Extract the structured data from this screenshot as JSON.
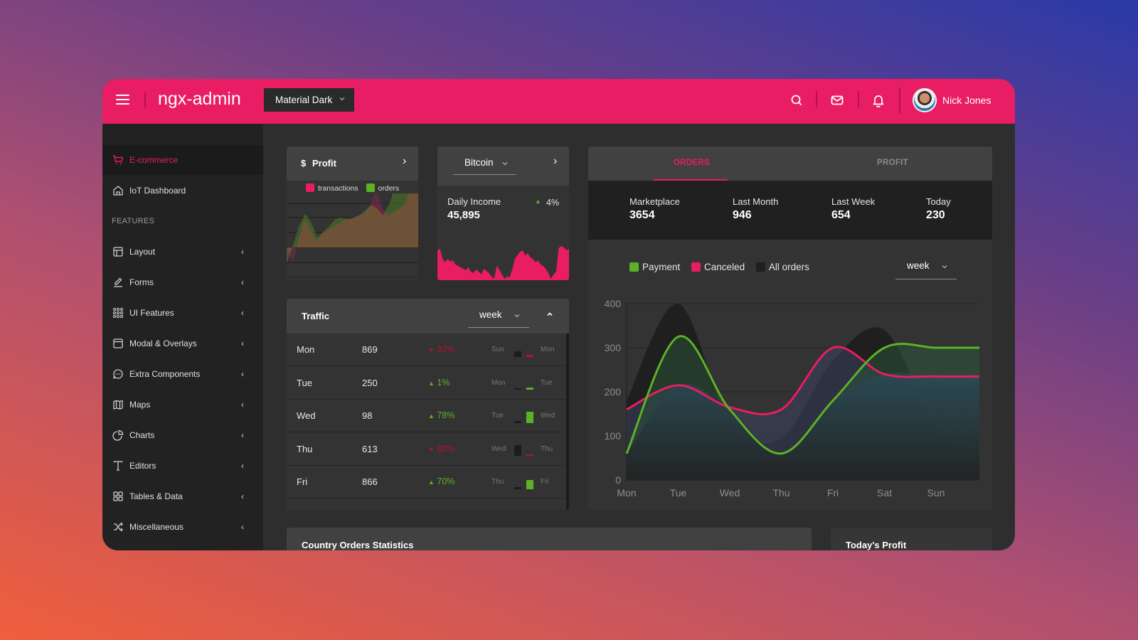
{
  "header": {
    "brand": "ngx-admin",
    "theme": "Material Dark",
    "user_name": "Nick Jones",
    "icons": [
      "menu-icon",
      "search-icon",
      "mail-icon",
      "bell-icon"
    ]
  },
  "sidebar": {
    "items": [
      {
        "label": "E-commerce",
        "icon": "shopping-cart-icon",
        "active": true
      },
      {
        "label": "IoT Dashboard",
        "icon": "home-icon"
      }
    ],
    "group_label": "FEATURES",
    "feature_items": [
      {
        "label": "Layout",
        "icon": "layout-icon"
      },
      {
        "label": "Forms",
        "icon": "edit-icon"
      },
      {
        "label": "UI Features",
        "icon": "grid-dots-icon"
      },
      {
        "label": "Modal & Overlays",
        "icon": "browser-icon"
      },
      {
        "label": "Extra Components",
        "icon": "message-circle-icon"
      },
      {
        "label": "Maps",
        "icon": "map-icon"
      },
      {
        "label": "Charts",
        "icon": "pie-chart-icon"
      },
      {
        "label": "Editors",
        "icon": "text-icon"
      },
      {
        "label": "Tables & Data",
        "icon": "grid-icon"
      },
      {
        "label": "Miscellaneous",
        "icon": "shuffle-icon"
      }
    ]
  },
  "profit_card": {
    "title": "Profit",
    "currency_symbol": "$",
    "legend": [
      {
        "label": "transactions",
        "color": "#e91d63"
      },
      {
        "label": "orders",
        "color": "#5db127"
      }
    ]
  },
  "bitcoin_card": {
    "selector": "Bitcoin",
    "label": "Daily Income",
    "value": "45,895",
    "delta": "4%",
    "delta_dir": "up"
  },
  "traffic": {
    "title": "Traffic",
    "period": "week",
    "rows": [
      {
        "day": "Mon",
        "value": "869",
        "delta": "32%",
        "dir": "down",
        "prev": "Sun",
        "cur": "Mon",
        "prev_level": 0.3,
        "cur_level": 0.1
      },
      {
        "day": "Tue",
        "value": "250",
        "delta": "1%",
        "dir": "up",
        "prev": "Mon",
        "cur": "Tue",
        "prev_level": 0.1,
        "cur_level": 0.12
      },
      {
        "day": "Wed",
        "value": "98",
        "delta": "78%",
        "dir": "up",
        "prev": "Tue",
        "cur": "Wed",
        "prev_level": 0.12,
        "cur_level": 0.6
      },
      {
        "day": "Thu",
        "value": "613",
        "delta": "82%",
        "dir": "down",
        "prev": "Wed",
        "cur": "Thu",
        "prev_level": 0.6,
        "cur_level": 0.1
      },
      {
        "day": "Fri",
        "value": "866",
        "delta": "70%",
        "dir": "up",
        "prev": "Thu",
        "cur": "Fri",
        "prev_level": 0.1,
        "cur_level": 0.5
      }
    ]
  },
  "orders_card": {
    "tabs": [
      {
        "label": "ORDERS",
        "active": true
      },
      {
        "label": "PROFIT",
        "active": false
      }
    ],
    "stats": [
      {
        "label": "Marketplace",
        "value": "3654"
      },
      {
        "label": "Last Month",
        "value": "946"
      },
      {
        "label": "Last Week",
        "value": "654"
      },
      {
        "label": "Today",
        "value": "230"
      }
    ],
    "period": "week"
  },
  "chart_data": {
    "type": "area",
    "categories": [
      "Mon",
      "Tue",
      "Wed",
      "Thu",
      "Fri",
      "Sat",
      "Sun"
    ],
    "series": [
      {
        "name": "Payment",
        "color": "#5db127",
        "values": [
          60,
          325,
          160,
          60,
          180,
          300,
          300
        ]
      },
      {
        "name": "Canceled",
        "color": "#e91d63",
        "values": [
          160,
          215,
          165,
          160,
          300,
          240,
          235
        ]
      },
      {
        "name": "All orders",
        "color": "#1f1f1f",
        "values": [
          180,
          400,
          130,
          95,
          270,
          340,
          120
        ]
      }
    ],
    "ylim": [
      0,
      400
    ],
    "yticks": [
      0,
      100,
      200,
      300,
      400
    ],
    "legend": "top-left",
    "grid": true
  },
  "bottom_cards": {
    "country_title": "Country Orders Statistics",
    "today_profit_title": "Today's Profit"
  }
}
